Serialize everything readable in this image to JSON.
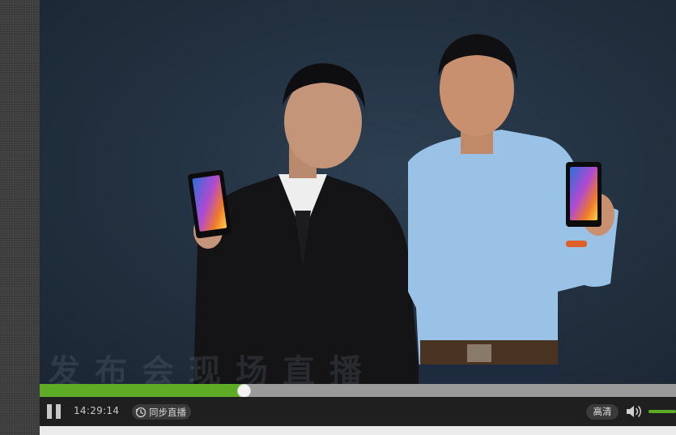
{
  "video": {
    "stage_text": "发布会现场直播"
  },
  "progress": {
    "played_fraction": 0.32
  },
  "controls": {
    "time": "14:29:14",
    "sync_live_label": "同步直播",
    "quality_label": "高清",
    "volume_fraction": 1.0
  },
  "colors": {
    "accent": "#5eac25",
    "control_bg": "#1f1f1f",
    "track_bg": "#9a9a9a"
  },
  "icons": [
    "pause-icon",
    "clock-icon",
    "speaker-icon"
  ]
}
